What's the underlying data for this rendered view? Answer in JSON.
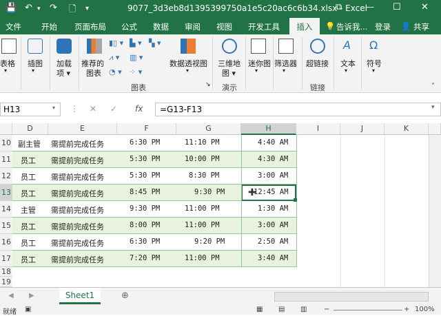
{
  "title": "9077_3d3eb8d1395399750a1e5c20ac6c6b34.xlsx - Excel",
  "window_controls": {
    "restore": "⧉",
    "minimize": "—",
    "maximize": "☐",
    "close": "✕"
  },
  "tabs": [
    "文件",
    "开始",
    "页面布局",
    "公式",
    "数据",
    "审阅",
    "视图",
    "开发工具",
    "插入",
    "告诉我...",
    "登录",
    "共享"
  ],
  "active_tab": "插入",
  "ribbon": {
    "table": "表格",
    "illustrations": "插图",
    "addins": "加载\n项",
    "recommended_charts": "推荐的\n图表",
    "pivot_chart": "数据透视图",
    "map3d": "三维地\n图",
    "sparklines": "迷你图",
    "filters": "筛选器",
    "hyperlink": "超链接",
    "text": "文本",
    "symbols": "符号",
    "group_charts": "图表",
    "group_tours": "演示",
    "group_links": "链接"
  },
  "namebox": "H13",
  "formula": "=G13-F13",
  "formula_fx": "fx",
  "columns": [
    "D",
    "E",
    "F",
    "G",
    "H",
    "I",
    "J",
    "K"
  ],
  "rows": [
    {
      "num": "10",
      "d": "副主管",
      "e": "需提前完成任务",
      "f": "6:30 PM",
      "g": "11:10 PM",
      "h": "4:40 AM"
    },
    {
      "num": "11",
      "d": "员工",
      "e": "需提前完成任务",
      "f": "5:30 PM",
      "g": "10:00 PM",
      "h": "4:30 AM"
    },
    {
      "num": "12",
      "d": "员工",
      "e": "需提前完成任务",
      "f": "5:30 PM",
      "g": "8:30 PM",
      "h": "3:00 AM"
    },
    {
      "num": "13",
      "d": "员工",
      "e": "需提前完成任务",
      "f": "8:45 PM",
      "g": "9:30 PM",
      "h": "12:45 AM"
    },
    {
      "num": "14",
      "d": "主管",
      "e": "需提前完成任务",
      "f": "9:30 PM",
      "g": "11:00 PM",
      "h": "1:30 AM"
    },
    {
      "num": "15",
      "d": "员工",
      "e": "需提前完成任务",
      "f": "8:00 PM",
      "g": "11:00 PM",
      "h": "3:00 AM"
    },
    {
      "num": "16",
      "d": "员工",
      "e": "需提前完成任务",
      "f": "6:30 PM",
      "g": "9:20 PM",
      "h": "2:50 AM"
    },
    {
      "num": "17",
      "d": "员工",
      "e": "需提前完成任务",
      "f": "7:20 PM",
      "g": "11:00 PM",
      "h": "3:40 AM"
    }
  ],
  "empty_rows": [
    "18",
    "19"
  ],
  "sheet_tab": "Sheet1",
  "status_left": "就绪",
  "zoom": "100%"
}
